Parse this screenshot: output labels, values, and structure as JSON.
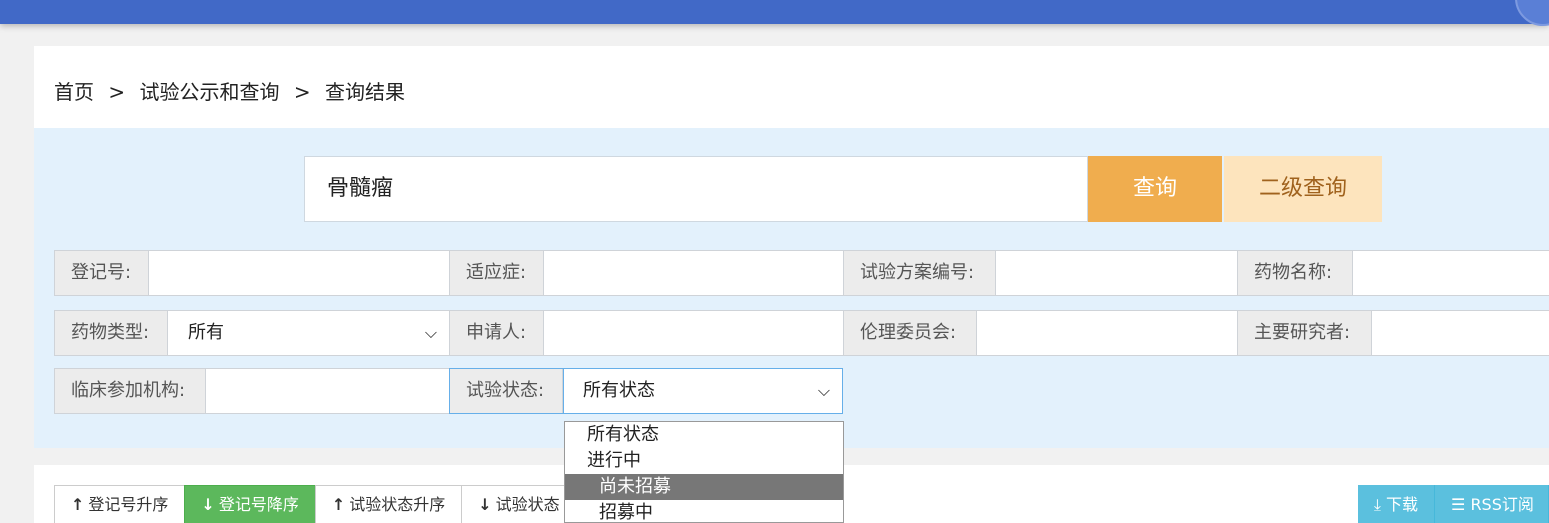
{
  "breadcrumb": {
    "home": "首页",
    "sep1": ">",
    "section": "试验公示和查询",
    "sep2": ">",
    "current": "查询结果"
  },
  "search": {
    "value": "骨髓瘤",
    "query_label": "查询",
    "advanced_label": "二级查询"
  },
  "filters": {
    "reg_no": {
      "label": "登记号:",
      "value": ""
    },
    "indication": {
      "label": "适应症:",
      "value": ""
    },
    "protocol_no": {
      "label": "试验方案编号:",
      "value": ""
    },
    "drug_name": {
      "label": "药物名称:",
      "value": ""
    },
    "drug_type": {
      "label": "药物类型:",
      "value": "所有"
    },
    "applicant": {
      "label": "申请人:",
      "value": ""
    },
    "ethics": {
      "label": "伦理委员会:",
      "value": ""
    },
    "pi": {
      "label": "主要研究者:",
      "value": ""
    },
    "institution": {
      "label": "临床参加机构:",
      "value": ""
    },
    "status": {
      "label": "试验状态:",
      "value": "所有状态"
    }
  },
  "status_dropdown": {
    "options": [
      "所有状态",
      "进行中",
      "尚未招募",
      "招募中"
    ],
    "highlighted": "尚未招募"
  },
  "sort": {
    "reg_asc": "登记号升序",
    "reg_desc": "登记号降序",
    "status_asc": "试验状态升序",
    "status_desc": "试验状态"
  },
  "actions": {
    "download": "下载",
    "rss": "RSS订阅"
  },
  "colors": {
    "topbar": "#4169c7",
    "query_button": "#f0ad4e",
    "advanced_button": "#fde4bd",
    "sort_active": "#5cb85c",
    "action_button": "#5bc0de"
  }
}
